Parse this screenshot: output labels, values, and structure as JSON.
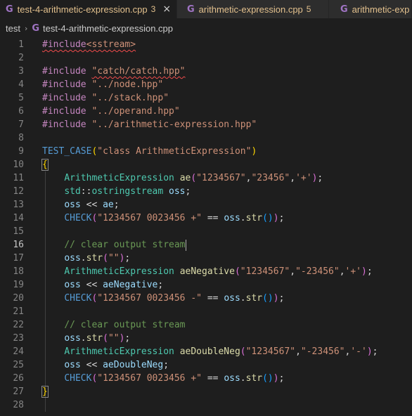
{
  "tabs": [
    {
      "label": "test-4-arithmetic-expression.cpp",
      "count": "3",
      "icon": "cpp-file-icon",
      "active": true
    },
    {
      "label": "arithmetic-expression.cpp",
      "count": "5",
      "icon": "cpp-file-icon",
      "active": false
    },
    {
      "label": "arithmetic-exp",
      "count": "",
      "icon": "cpp-file-icon",
      "active": false
    }
  ],
  "icons": {
    "file_glyph": "G",
    "close_glyph": "×",
    "chevron_glyph": "›"
  },
  "breadcrumb": {
    "folder": "test",
    "file": "test-4-arithmetic-expression.cpp"
  },
  "editor": {
    "current_line": 16,
    "lines": [
      {
        "n": "1",
        "tokens": [
          [
            "t-kw squig",
            "#include"
          ],
          [
            "t-str squig",
            "<sstream>"
          ]
        ]
      },
      {
        "n": "2",
        "tokens": []
      },
      {
        "n": "3",
        "tokens": [
          [
            "t-kw",
            "#include"
          ],
          [
            "t-op",
            " "
          ],
          [
            "t-str squig",
            "\"catch/catch.hpp\""
          ]
        ]
      },
      {
        "n": "4",
        "tokens": [
          [
            "t-kw",
            "#include"
          ],
          [
            "t-op",
            " "
          ],
          [
            "t-str",
            "\"../node.hpp\""
          ]
        ]
      },
      {
        "n": "5",
        "tokens": [
          [
            "t-kw",
            "#include"
          ],
          [
            "t-op",
            " "
          ],
          [
            "t-str",
            "\"../stack.hpp\""
          ]
        ]
      },
      {
        "n": "6",
        "tokens": [
          [
            "t-kw",
            "#include"
          ],
          [
            "t-op",
            " "
          ],
          [
            "t-str",
            "\"../operand.hpp\""
          ]
        ]
      },
      {
        "n": "7",
        "tokens": [
          [
            "t-kw",
            "#include"
          ],
          [
            "t-op",
            " "
          ],
          [
            "t-str",
            "\"../arithmetic-expression.hpp\""
          ]
        ]
      },
      {
        "n": "8",
        "tokens": []
      },
      {
        "n": "9",
        "tokens": [
          [
            "t-macro",
            "TEST_CASE"
          ],
          [
            "t-br1",
            "("
          ],
          [
            "t-str",
            "\"class ArithmeticExpression\""
          ],
          [
            "t-br1",
            ")"
          ]
        ]
      },
      {
        "n": "10",
        "tokens": [
          [
            "t-br1 bracket-match",
            "{"
          ]
        ]
      },
      {
        "n": "11",
        "tokens": [
          [
            "t-op",
            "    "
          ],
          [
            "t-cls",
            "ArithmeticExpression"
          ],
          [
            "t-op",
            " "
          ],
          [
            "t-fn",
            "ae"
          ],
          [
            "t-br2",
            "("
          ],
          [
            "t-str",
            "\"1234567\""
          ],
          [
            "t-op",
            ","
          ],
          [
            "t-str",
            "\"23456\""
          ],
          [
            "t-op",
            ","
          ],
          [
            "t-str",
            "'+'"
          ],
          [
            "t-br2",
            ")"
          ],
          [
            "t-op",
            ";"
          ]
        ]
      },
      {
        "n": "12",
        "tokens": [
          [
            "t-op",
            "    "
          ],
          [
            "t-cls",
            "std"
          ],
          [
            "t-op",
            "::"
          ],
          [
            "t-cls",
            "ostringstream"
          ],
          [
            "t-op",
            " "
          ],
          [
            "t-var",
            "oss"
          ],
          [
            "t-op",
            ";"
          ]
        ]
      },
      {
        "n": "13",
        "tokens": [
          [
            "t-op",
            "    "
          ],
          [
            "t-var",
            "oss"
          ],
          [
            "t-op",
            " << "
          ],
          [
            "t-var",
            "ae"
          ],
          [
            "t-op",
            ";"
          ]
        ]
      },
      {
        "n": "14",
        "tokens": [
          [
            "t-op",
            "    "
          ],
          [
            "t-macro",
            "CHECK"
          ],
          [
            "t-br2",
            "("
          ],
          [
            "t-str",
            "\"1234567 0023456 +\""
          ],
          [
            "t-op",
            " == "
          ],
          [
            "t-var",
            "oss"
          ],
          [
            "t-op",
            "."
          ],
          [
            "t-fn",
            "str"
          ],
          [
            "t-br3",
            "()"
          ],
          [
            "t-br2",
            ")"
          ],
          [
            "t-op",
            ";"
          ]
        ]
      },
      {
        "n": "15",
        "tokens": []
      },
      {
        "n": "16",
        "tokens": [
          [
            "t-op",
            "    "
          ],
          [
            "t-cmt",
            "// clear output stream"
          ]
        ],
        "cursor": true
      },
      {
        "n": "17",
        "tokens": [
          [
            "t-op",
            "    "
          ],
          [
            "t-var",
            "oss"
          ],
          [
            "t-op",
            "."
          ],
          [
            "t-fn",
            "str"
          ],
          [
            "t-br2",
            "("
          ],
          [
            "t-str",
            "\"\""
          ],
          [
            "t-br2",
            ")"
          ],
          [
            "t-op",
            ";"
          ]
        ]
      },
      {
        "n": "18",
        "tokens": [
          [
            "t-op",
            "    "
          ],
          [
            "t-cls",
            "ArithmeticExpression"
          ],
          [
            "t-op",
            " "
          ],
          [
            "t-fn",
            "aeNegative"
          ],
          [
            "t-br2",
            "("
          ],
          [
            "t-str",
            "\"1234567\""
          ],
          [
            "t-op",
            ","
          ],
          [
            "t-str",
            "\"-23456\""
          ],
          [
            "t-op",
            ","
          ],
          [
            "t-str",
            "'+'"
          ],
          [
            "t-br2",
            ")"
          ],
          [
            "t-op",
            ";"
          ]
        ]
      },
      {
        "n": "19",
        "tokens": [
          [
            "t-op",
            "    "
          ],
          [
            "t-var",
            "oss"
          ],
          [
            "t-op",
            " << "
          ],
          [
            "t-var",
            "aeNegative"
          ],
          [
            "t-op",
            ";"
          ]
        ]
      },
      {
        "n": "20",
        "tokens": [
          [
            "t-op",
            "    "
          ],
          [
            "t-macro",
            "CHECK"
          ],
          [
            "t-br2",
            "("
          ],
          [
            "t-str",
            "\"1234567 0023456 -\""
          ],
          [
            "t-op",
            " == "
          ],
          [
            "t-var",
            "oss"
          ],
          [
            "t-op",
            "."
          ],
          [
            "t-fn",
            "str"
          ],
          [
            "t-br3",
            "()"
          ],
          [
            "t-br2",
            ")"
          ],
          [
            "t-op",
            ";"
          ]
        ]
      },
      {
        "n": "21",
        "tokens": []
      },
      {
        "n": "22",
        "tokens": [
          [
            "t-op",
            "    "
          ],
          [
            "t-cmt",
            "// clear output stream"
          ]
        ]
      },
      {
        "n": "23",
        "tokens": [
          [
            "t-op",
            "    "
          ],
          [
            "t-var",
            "oss"
          ],
          [
            "t-op",
            "."
          ],
          [
            "t-fn",
            "str"
          ],
          [
            "t-br2",
            "("
          ],
          [
            "t-str",
            "\"\""
          ],
          [
            "t-br2",
            ")"
          ],
          [
            "t-op",
            ";"
          ]
        ]
      },
      {
        "n": "24",
        "tokens": [
          [
            "t-op",
            "    "
          ],
          [
            "t-cls",
            "ArithmeticExpression"
          ],
          [
            "t-op",
            " "
          ],
          [
            "t-fn",
            "aeDoubleNeg"
          ],
          [
            "t-br2",
            "("
          ],
          [
            "t-str",
            "\"1234567\""
          ],
          [
            "t-op",
            ","
          ],
          [
            "t-str",
            "\"-23456\""
          ],
          [
            "t-op",
            ","
          ],
          [
            "t-str",
            "'-'"
          ],
          [
            "t-br2",
            ")"
          ],
          [
            "t-op",
            ";"
          ]
        ]
      },
      {
        "n": "25",
        "tokens": [
          [
            "t-op",
            "    "
          ],
          [
            "t-var",
            "oss"
          ],
          [
            "t-op",
            " << "
          ],
          [
            "t-var",
            "aeDoubleNeg"
          ],
          [
            "t-op",
            ";"
          ]
        ]
      },
      {
        "n": "26",
        "tokens": [
          [
            "t-op",
            "    "
          ],
          [
            "t-macro",
            "CHECK"
          ],
          [
            "t-br2",
            "("
          ],
          [
            "t-str",
            "\"1234567 0023456 +\""
          ],
          [
            "t-op",
            " == "
          ],
          [
            "t-var",
            "oss"
          ],
          [
            "t-op",
            "."
          ],
          [
            "t-fn",
            "str"
          ],
          [
            "t-br3",
            "()"
          ],
          [
            "t-br2",
            ")"
          ],
          [
            "t-op",
            ";"
          ]
        ]
      },
      {
        "n": "27",
        "tokens": [
          [
            "t-br1 bracket-match",
            "}"
          ]
        ]
      },
      {
        "n": "28",
        "tokens": []
      }
    ]
  }
}
